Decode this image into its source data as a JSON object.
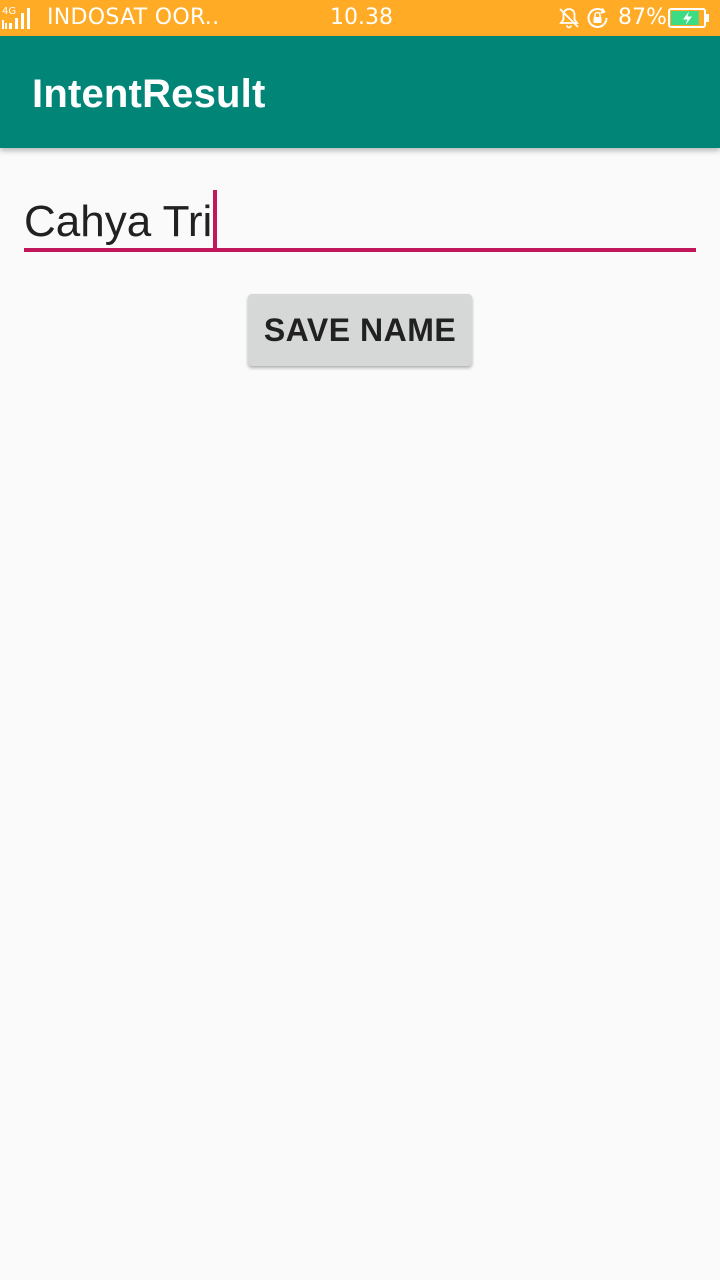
{
  "status_bar": {
    "network_type": "4G",
    "carrier": "INDOSAT OOR..",
    "time": "10.38",
    "battery_percent": "87%",
    "battery_level": 0.87,
    "icons": [
      "signal-icon",
      "mute-notification-icon",
      "rotation-lock-icon",
      "battery-charging-icon"
    ],
    "background_color": "#ffab25"
  },
  "app_bar": {
    "title": "IntentResult",
    "background_color": "#008577"
  },
  "name_input": {
    "value": "Cahya Tri",
    "accent_color": "#c2185b"
  },
  "save_button": {
    "label": "SAVE NAME"
  }
}
